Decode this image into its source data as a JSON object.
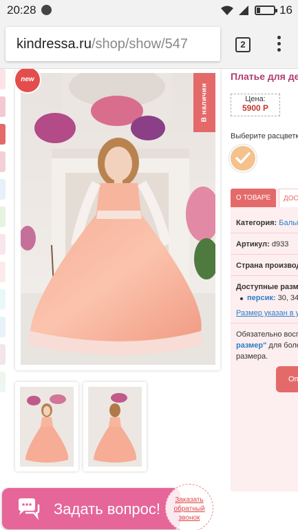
{
  "status_bar": {
    "time": "20:28",
    "network": "4G",
    "battery_level": "16"
  },
  "browser": {
    "url_host": "kindressa.ru",
    "url_path": "/shop/show/547",
    "tab_count": "2"
  },
  "product": {
    "badge_new": "new",
    "in_stock_label": "В наличии",
    "title": "Платье для дев",
    "price_label": "Цена:",
    "price_value": "5900 Р",
    "choose_color_label": "Выберите расцветк"
  },
  "tabs": {
    "active": "О ТОВАРЕ",
    "second": "ДОСТ"
  },
  "info": {
    "category_label": "Категория:",
    "category_value": "Бальн",
    "article_label": "Артикул:",
    "article_value": "d933",
    "country_label": "Страна производи",
    "sizes_label": "Доступные размер",
    "size_color": "персик:",
    "size_values": "30, 34,",
    "size_link": "Размер указан в усл",
    "note_line1": "Обязательно восп",
    "note_bold": "размер\"",
    "note_line2_rest": "для более",
    "note_line3": "размера.",
    "order_button": "Оп"
  },
  "chat": {
    "ask_label": "Задать вопрос!",
    "callback_lines": [
      "Заказать",
      "обратный",
      "звонок"
    ]
  },
  "colors": {
    "accent": "#e46a6a",
    "title": "#b03a6f",
    "price": "#c0392b",
    "chat": "#e6669a",
    "link": "#2a7fc8"
  }
}
